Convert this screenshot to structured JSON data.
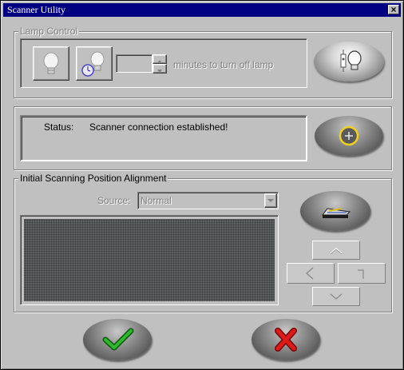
{
  "window": {
    "title": "Scanner Utility",
    "close_glyph": "×"
  },
  "lamp": {
    "group_label": "Lamp Control",
    "minutes_value": "",
    "minutes_label": "minutes to turn off lamp"
  },
  "status": {
    "label": "Status:",
    "text": "Scanner connection established!"
  },
  "alignment": {
    "group_label": "Initial Scanning Position Alignment",
    "source_label": "Source:",
    "source_value": "Normal"
  },
  "icons": {
    "lamp_on": "light-bulb-icon",
    "lamp_timer": "light-bulb-clock-icon",
    "lamp_toggle": "lamp-switch-bulb-icon",
    "connect": "plus-circle-icon",
    "scanner": "scanner-icon",
    "ok": "check-icon",
    "cancel": "x-icon"
  },
  "colors": {
    "titlebar": "#000080",
    "check": "#1f9a1f",
    "cross": "#cc1111",
    "connect_ring": "#f0d020"
  }
}
